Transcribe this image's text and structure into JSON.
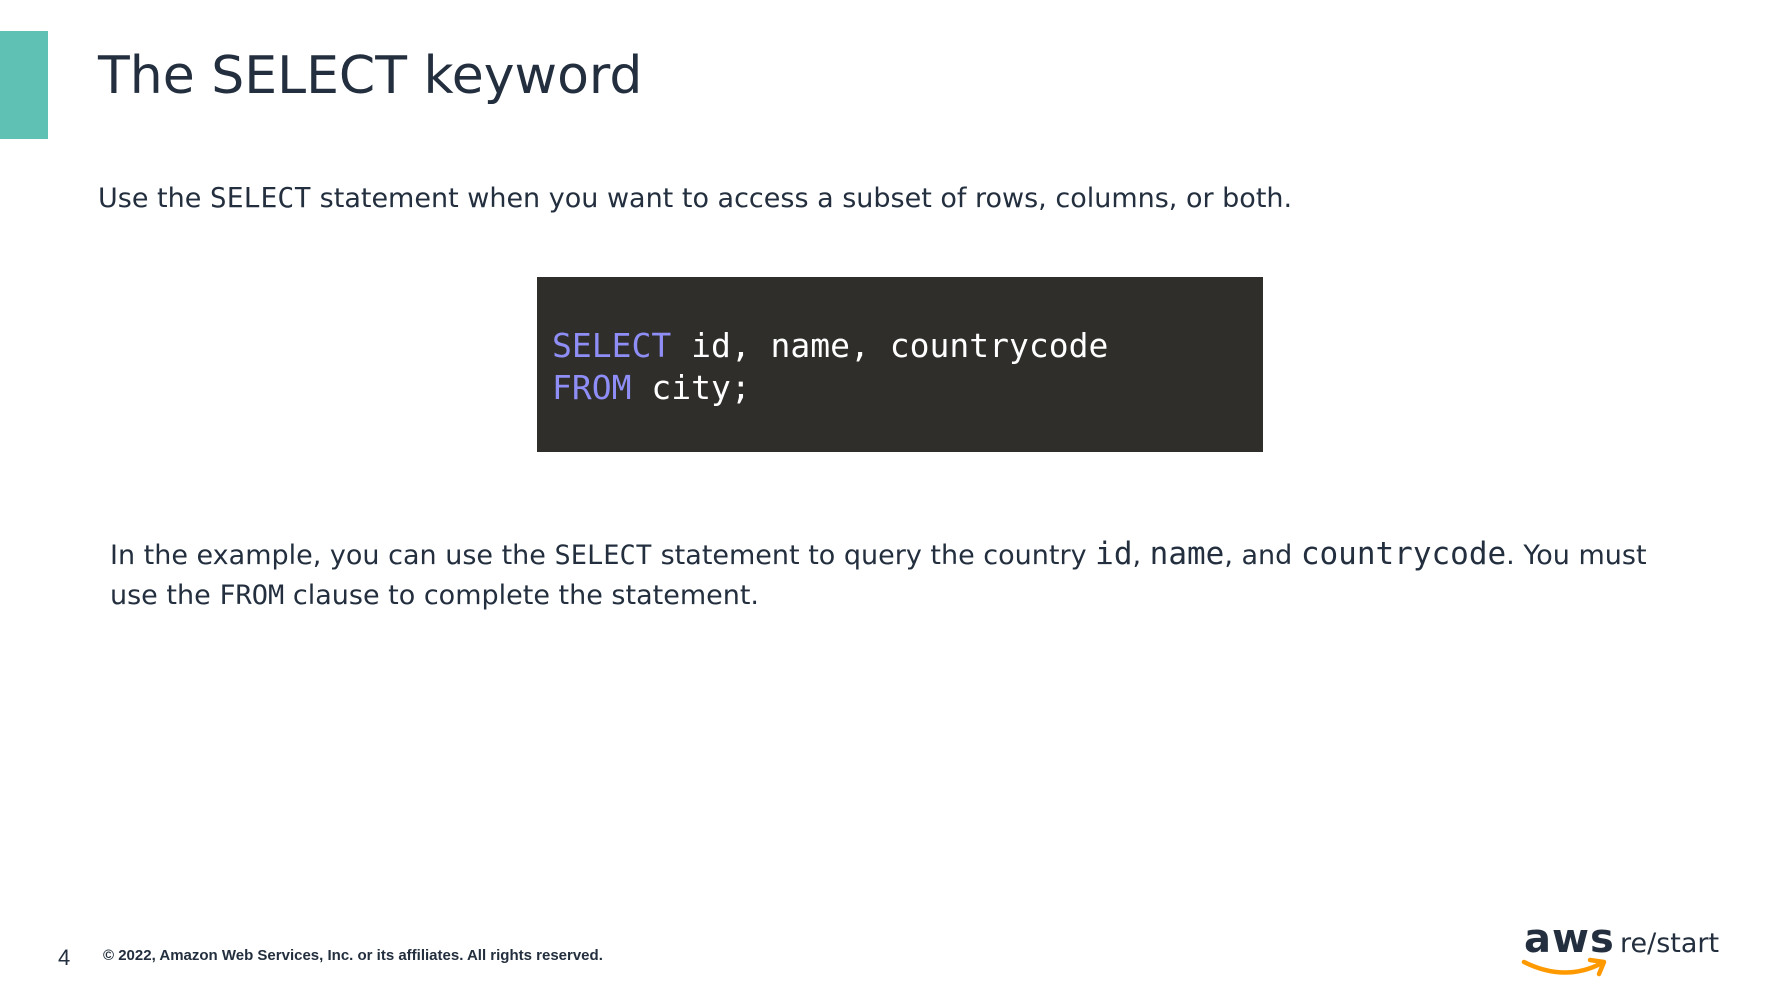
{
  "colors": {
    "accent": "#5fc1b3",
    "text": "#232f3e",
    "code_bg": "#2f2e2a",
    "code_keyword": "#8f8ef7",
    "code_text": "#ffffff",
    "logo_smile": "#ff9900"
  },
  "slide": {
    "title": "The SELECT keyword",
    "intro": {
      "before": "Use the ",
      "keyword": "SELECT",
      "after": " statement when you want to access a subset of rows, columns, or both."
    },
    "code": {
      "line1_keyword": "SELECT",
      "line1_rest": " id, name, countrycode",
      "line2_keyword": "FROM",
      "line2_rest": " city;"
    },
    "explanation": {
      "p1": "In the example, you can use the ",
      "kw_select": "SELECT",
      "p2": " statement to query the country ",
      "col_id": "id",
      "sep1": ", ",
      "col_name": "name",
      "sep2": ", and ",
      "col_countrycode": "countrycode",
      "p3": ". You must use the ",
      "kw_from": "FROM",
      "p4": " clause to complete the statement."
    }
  },
  "footer": {
    "slide_number": "4",
    "copyright": "© 2022, Amazon Web Services, Inc. or its affiliates. All rights reserved.",
    "logo_main": "aws",
    "logo_sub": "re/start",
    "logo_icon": "aws-smile-arrow"
  }
}
